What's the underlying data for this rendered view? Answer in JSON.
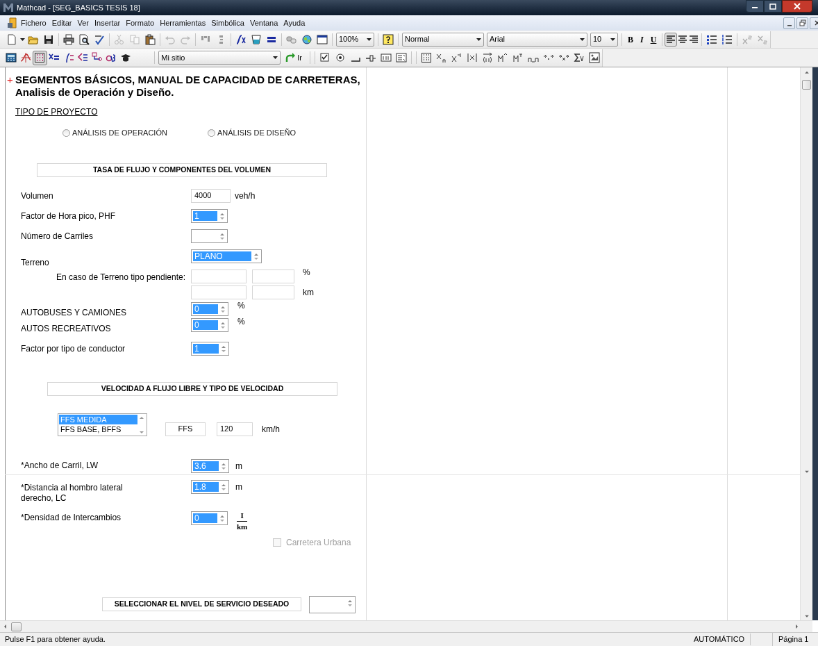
{
  "window": {
    "title": "Mathcad - [SEG_BASICS TESIS 18]"
  },
  "menu": [
    "Fichero",
    "Editar",
    "Ver",
    "Insertar",
    "Formato",
    "Herramientas",
    "Simbólica",
    "Ventana",
    "Ayuda"
  ],
  "toolbar": {
    "edit_tools": [
      {
        "disabled": true
      },
      {
        "disabled": true
      },
      {
        "disabled": false
      }
    ],
    "history": [
      {
        "disabled": true
      },
      {
        "disabled": true
      }
    ],
    "zoom": "100%",
    "style": "Normal",
    "font": "Arial",
    "size": "10",
    "bold": "B",
    "italic": "I",
    "underline": "U",
    "alignments": [
      {
        "selected": true
      },
      {
        "selected": false
      },
      {
        "selected": false
      }
    ],
    "scripts": [
      {
        "disabled": true
      },
      {
        "disabled": true
      }
    ]
  },
  "math_toolbar": {
    "palettes": [
      {
        "selected": false
      },
      {
        "selected": false
      },
      {
        "selected": true
      },
      {
        "selected": false
      },
      {
        "selected": false
      },
      {
        "selected": false
      },
      {
        "selected": false
      },
      {
        "selected": false
      },
      {
        "selected": false
      }
    ],
    "address": "Mi sitio",
    "go": "Ir"
  },
  "worksheet": {
    "marker": "+",
    "title": "SEGMENTOS BÁSICOS, MANUAL DE CAPACIDAD DE CARRETERAS, Analisis de Operación y Diseño.",
    "project_type": {
      "heading": "TIPO DE PROYECTO",
      "options": [
        {
          "label": "ANÁLISIS DE OPERACIÓN",
          "selected": false
        },
        {
          "label": "ANÁLISIS DE DISEÑO",
          "selected": false
        }
      ]
    },
    "flow_section": {
      "heading": "TASA DE FLUJO Y COMPONENTES DEL VOLUMEN",
      "inputs": [
        {
          "kind": "field",
          "label": "Volumen",
          "value": "4000",
          "unit": "veh/h"
        },
        {
          "kind": "spinner",
          "label": "Factor de Hora pico, PHF",
          "value": "1",
          "highlighted": true
        },
        {
          "kind": "spinner",
          "label": "Número de Carriles",
          "highlighted": false
        },
        {
          "kind": "spinner",
          "label": "Terreno",
          "value": "PLANO",
          "highlighted": true
        },
        {
          "kind": "grade",
          "label": "En caso de Terreno tipo pendiente:",
          "units": [
            "%",
            "km"
          ]
        },
        {
          "kind": "spinner",
          "label": "AUTOBUSES Y CAMIONES",
          "value": "0",
          "highlighted": true,
          "unit": "%"
        },
        {
          "kind": "spinner",
          "label": "AUTOS RECREATIVOS",
          "value": "0",
          "highlighted": true,
          "unit": "%"
        },
        {
          "kind": "spinner",
          "label": "Factor por tipo de conductor",
          "value": "1",
          "highlighted": true
        }
      ]
    },
    "speed_section": {
      "heading": "VELOCIDAD A FLUJO LIBRE Y TIPO DE VELOCIDAD",
      "speed_types": [
        {
          "label": "FFS MEDIDA",
          "selected": true
        },
        {
          "label": "FFS BASE, BFFS",
          "selected": false
        }
      ],
      "speed_name": "FFS",
      "speed_value": "120",
      "speed_unit": "km/h",
      "inputs": [
        {
          "label": "*Ancho de Carril, LW",
          "value": "3.6",
          "highlighted": true,
          "unit": "m"
        },
        {
          "label": "*Distancia al hombro lateral derecho, LC",
          "value": "1.8",
          "highlighted": true,
          "unit": "m"
        },
        {
          "label": "*Densidad de Intercambios",
          "value": "0",
          "highlighted": true,
          "unit_numerator": "I",
          "unit_denominator": "km"
        }
      ],
      "urban": {
        "label": "Carretera Urbana",
        "checked": false,
        "disabled": true
      }
    },
    "service": {
      "heading": "SELECCIONAR EL NIVEL DE SERVICIO DESEADO"
    }
  },
  "status_bar": {
    "hint": "Pulse F1 para obtener ayuda.",
    "mode": "AUTOMÁTICO",
    "page": "Página 1"
  }
}
